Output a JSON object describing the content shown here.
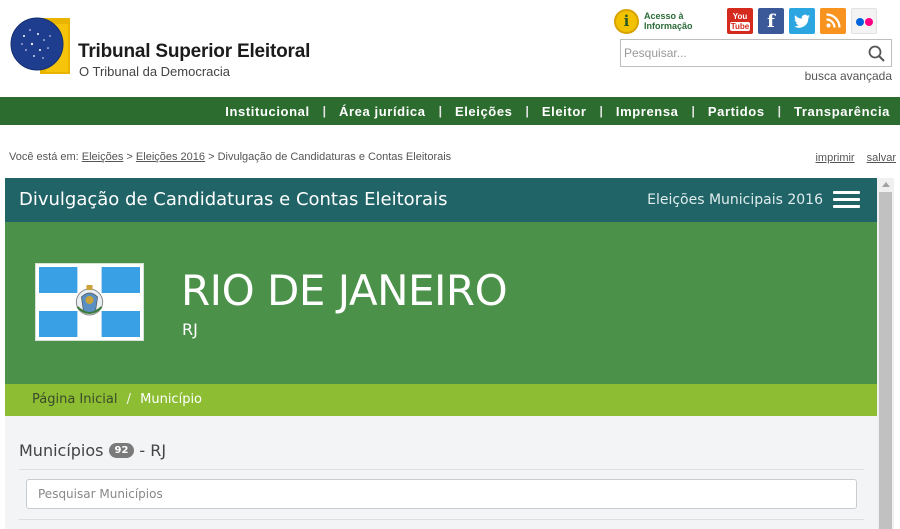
{
  "header": {
    "title": "Tribunal Superior Eleitoral",
    "subtitle": "O Tribunal da Democracia",
    "access_info": {
      "line1": "Acesso à",
      "line2": "Informação"
    },
    "social": {
      "youtube_line1": "You",
      "youtube_line2": "Tube",
      "facebook": "f"
    },
    "search_placeholder": "Pesquisar...",
    "advanced_search": "busca avançada"
  },
  "nav": {
    "items": [
      "Institucional",
      "Área jurídica",
      "Eleições",
      "Eleitor",
      "Imprensa",
      "Partidos",
      "Transparência"
    ]
  },
  "breadcrumb": {
    "prefix": "Você está em:",
    "links": [
      "Eleições",
      "Eleições 2016"
    ],
    "current": "Divulgação de Candidaturas e Contas Eleitorais",
    "separator": ">",
    "actions": [
      "imprimir",
      "salvar"
    ]
  },
  "app": {
    "title": "Divulgação de Candidaturas e Contas Eleitorais",
    "election": "Eleições Municipais 2016",
    "state_name": "RIO DE JANEIRO",
    "state_uf": "RJ",
    "crumb_home": "Página Inicial",
    "crumb_sep": "/",
    "crumb_current": "Município",
    "municipios_label": "Municípios",
    "municipios_count": "92",
    "municipios_suffix": "- RJ",
    "municipios_search_placeholder": "Pesquisar Municípios"
  },
  "colors": {
    "nav_green": "#2c6c2f",
    "app_teal": "#206468",
    "hero_green": "#4b9149",
    "crumb_lime": "#8cbd33",
    "flag_blue": "#3aa0e6"
  },
  "icons": [
    "globe-logo-icon",
    "info-icon",
    "youtube-icon",
    "facebook-icon",
    "twitter-icon",
    "rss-icon",
    "flickr-icon",
    "search-icon",
    "hamburger-menu-icon",
    "rio-de-janeiro-flag-icon"
  ]
}
